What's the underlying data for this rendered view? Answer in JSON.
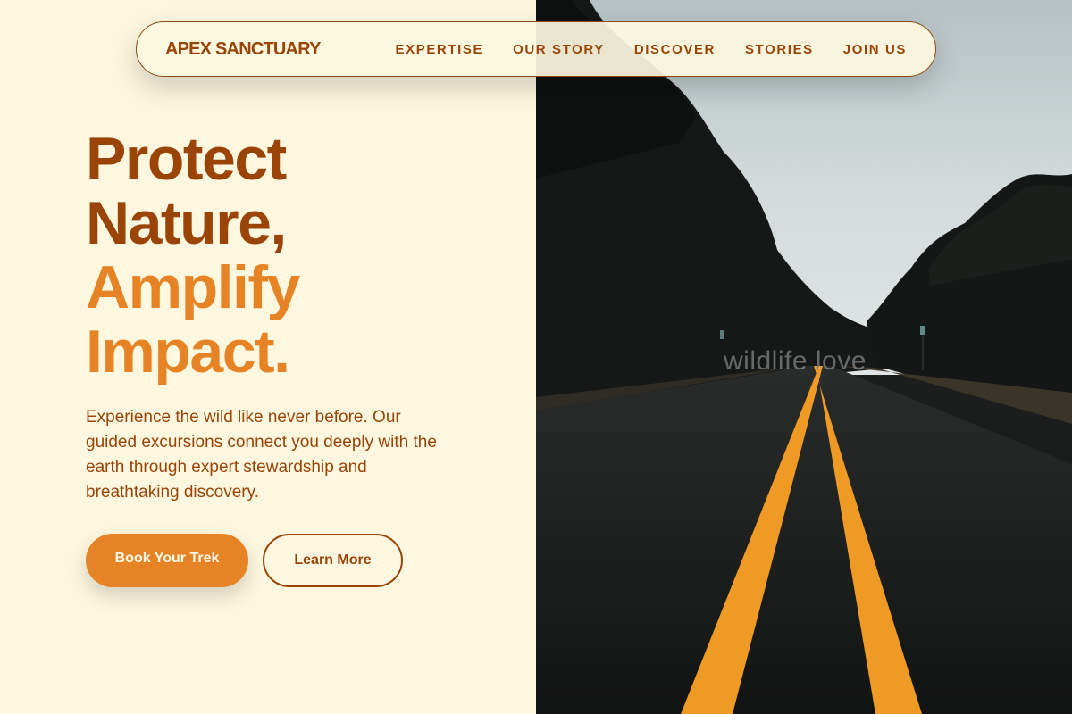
{
  "brand": {
    "name": "APEX SANCTUARY"
  },
  "nav": {
    "items": [
      {
        "label": "EXPERTISE"
      },
      {
        "label": "OUR STORY"
      },
      {
        "label": "DISCOVER"
      },
      {
        "label": "STORIES"
      },
      {
        "label": "JOIN US"
      }
    ]
  },
  "hero": {
    "title_lines": [
      {
        "text": "Protect"
      },
      {
        "text": "Nature,"
      },
      {
        "text": "Amplify"
      },
      {
        "text": "Impact."
      }
    ],
    "description": "Experience the wild like never before. Our guided excursions connect you deeply with the earth through expert stewardship and breathtaking discovery.",
    "primary_cta": "Book Your Trek",
    "secondary_cta": "Learn More"
  },
  "image": {
    "watermark": "wildlife love",
    "subject": "forest road with yellow center lines"
  },
  "colors": {
    "background": "#fdf7df",
    "brand_dark": "#9a4408",
    "accent": "#e68425",
    "road_line": "#f09a26"
  }
}
